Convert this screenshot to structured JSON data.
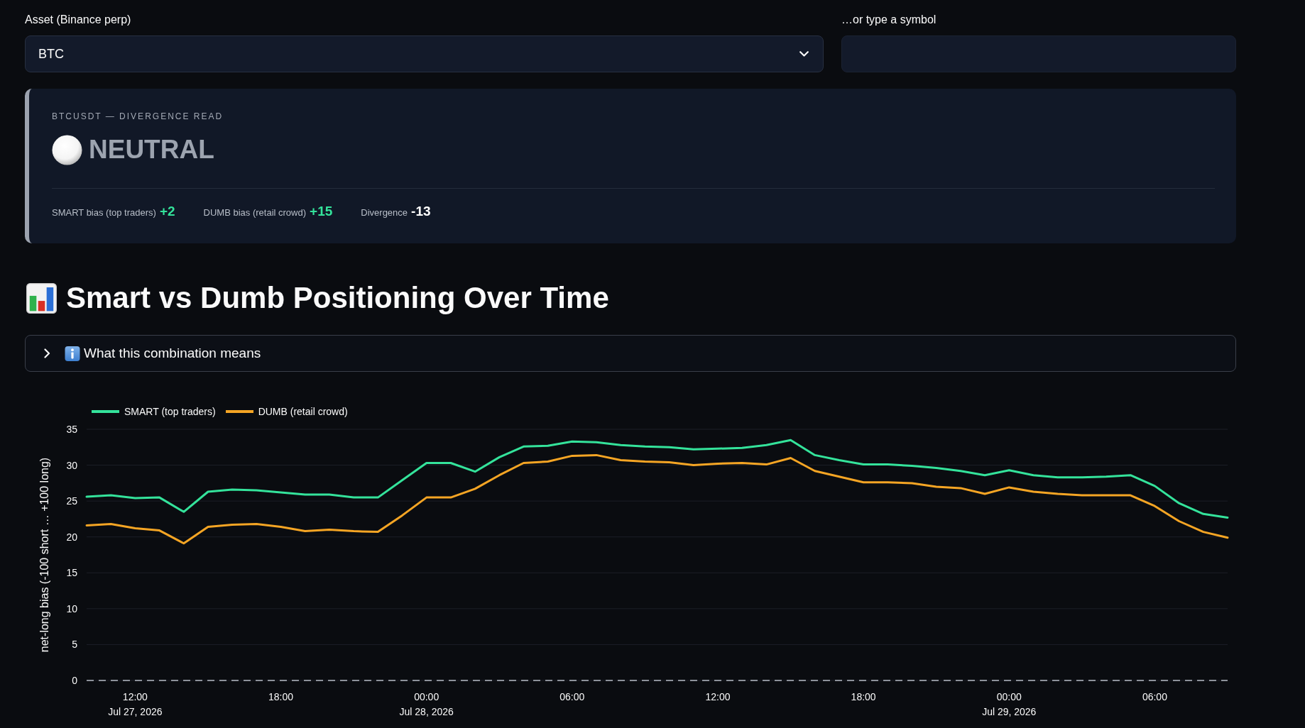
{
  "controls": {
    "asset_select": {
      "label": "Asset (Binance perp)",
      "value": "BTC"
    },
    "symbol_input": {
      "label": "…or type a symbol"
    }
  },
  "divergence_card": {
    "title": "BTCUSDT — DIVERGENCE READ",
    "signal": {
      "label": "NEUTRAL",
      "kind": "neutral"
    },
    "metrics": [
      {
        "label": "SMART bias (top traders)",
        "value": "+2",
        "color": "#34e39b"
      },
      {
        "label": "DUMB bias (retail crowd)",
        "value": "+15",
        "color": "#34e39b"
      },
      {
        "label": "Divergence",
        "value": "-13",
        "color": "#ffffff"
      }
    ]
  },
  "section": {
    "heading": "Smart vs Dumb Positioning Over Time",
    "expander": {
      "label": "What this combination means",
      "expanded": false
    },
    "chart": {
      "chart_data": {
        "type": "line",
        "ylabel": "net-long bias (-100 short … +100 long)",
        "x": [
          "2026-07-27T10:00",
          "2026-07-27T11:00",
          "2026-07-27T12:00",
          "2026-07-27T13:00",
          "2026-07-27T14:00",
          "2026-07-27T15:00",
          "2026-07-27T16:00",
          "2026-07-27T17:00",
          "2026-07-27T18:00",
          "2026-07-27T19:00",
          "2026-07-27T20:00",
          "2026-07-27T21:00",
          "2026-07-27T22:00",
          "2026-07-27T23:00",
          "2026-07-28T00:00",
          "2026-07-28T01:00",
          "2026-07-28T02:00",
          "2026-07-28T03:00",
          "2026-07-28T04:00",
          "2026-07-28T05:00",
          "2026-07-28T06:00",
          "2026-07-28T07:00",
          "2026-07-28T08:00",
          "2026-07-28T09:00",
          "2026-07-28T10:00",
          "2026-07-28T11:00",
          "2026-07-28T12:00",
          "2026-07-28T13:00",
          "2026-07-28T14:00",
          "2026-07-28T15:00",
          "2026-07-28T16:00",
          "2026-07-28T17:00",
          "2026-07-28T18:00",
          "2026-07-28T19:00",
          "2026-07-28T20:00",
          "2026-07-28T21:00",
          "2026-07-28T22:00",
          "2026-07-28T23:00",
          "2026-07-29T00:00",
          "2026-07-29T01:00",
          "2026-07-29T02:00",
          "2026-07-29T03:00",
          "2026-07-29T04:00",
          "2026-07-29T05:00",
          "2026-07-29T06:00",
          "2026-07-29T07:00",
          "2026-07-29T08:00",
          "2026-07-29T09:00"
        ],
        "series": [
          {
            "name": "SMART (top traders)",
            "color": "#34e39b",
            "values": [
              25.6,
              25.8,
              25.4,
              25.5,
              23.5,
              26.3,
              26.6,
              26.5,
              26.2,
              25.9,
              25.9,
              25.5,
              25.5,
              27.9,
              30.3,
              30.3,
              29.1,
              31.1,
              32.6,
              32.7,
              33.3,
              33.2,
              32.8,
              32.6,
              32.5,
              32.2,
              32.3,
              32.4,
              32.8,
              33.5,
              31.4,
              30.7,
              30.1,
              30.1,
              29.9,
              29.6,
              29.2,
              28.6,
              29.3,
              28.6,
              28.3,
              28.3,
              28.4,
              28.6,
              27.1,
              24.7,
              23.2,
              22.7
            ]
          },
          {
            "name": "DUMB (retail crowd)",
            "color": "#f5a524",
            "values": [
              21.6,
              21.8,
              21.2,
              20.9,
              19.1,
              21.4,
              21.7,
              21.8,
              21.4,
              20.8,
              21.0,
              20.8,
              20.7,
              23.0,
              25.5,
              25.5,
              26.7,
              28.6,
              30.3,
              30.5,
              31.3,
              31.4,
              30.7,
              30.5,
              30.4,
              30.0,
              30.2,
              30.3,
              30.1,
              31.0,
              29.2,
              28.4,
              27.6,
              27.6,
              27.5,
              27.0,
              26.8,
              26.0,
              26.9,
              26.3,
              26.0,
              25.8,
              25.8,
              25.8,
              24.3,
              22.2,
              20.7,
              19.9
            ]
          }
        ],
        "xlim": [
          "2026-07-27T10:00",
          "2026-07-29T09:00"
        ],
        "ylim": [
          0,
          35
        ],
        "xticks": [
          {
            "value": "2026-07-27T12:00",
            "label": "12:00\nJul 27, 2026"
          },
          {
            "value": "2026-07-27T18:00",
            "label": "18:00"
          },
          {
            "value": "2026-07-28T00:00",
            "label": "00:00\nJul 28, 2026"
          },
          {
            "value": "2026-07-28T06:00",
            "label": "06:00"
          },
          {
            "value": "2026-07-28T12:00",
            "label": "12:00"
          },
          {
            "value": "2026-07-28T18:00",
            "label": "18:00"
          },
          {
            "value": "2026-07-29T00:00",
            "label": "00:00\nJul 29, 2026"
          },
          {
            "value": "2026-07-29T06:00",
            "label": "06:00"
          }
        ],
        "yticks": [
          0,
          5,
          10,
          15,
          20,
          25,
          30,
          35
        ],
        "grid": true,
        "legend": true,
        "ref_lines": [
          {
            "axis": "y",
            "value": 0
          }
        ]
      }
    }
  }
}
